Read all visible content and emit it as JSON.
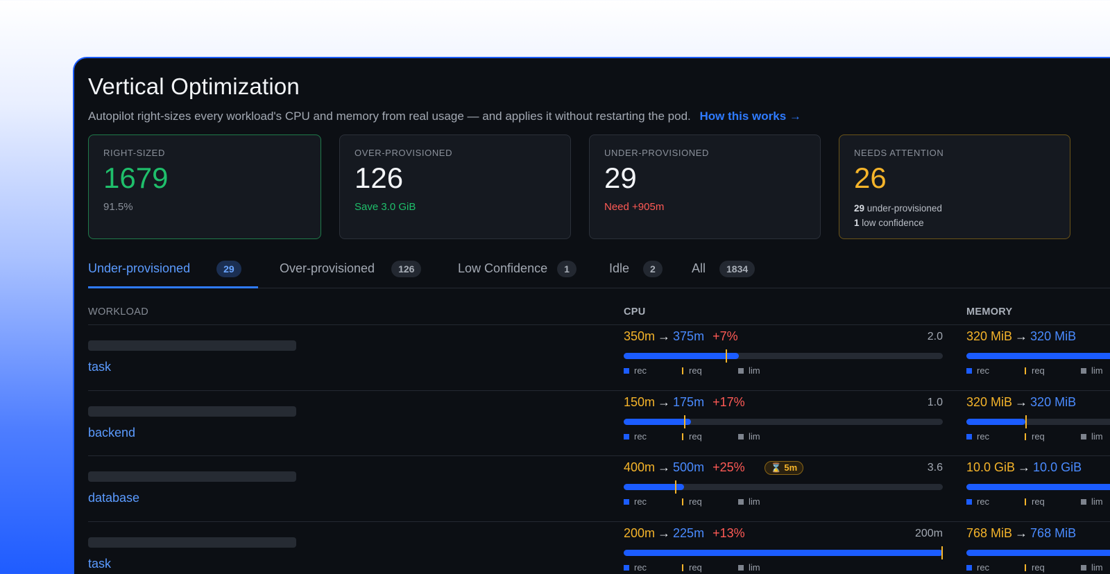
{
  "header": {
    "title": "Vertical Optimization",
    "subtitle": "Autopilot right-sizes every workload's CPU and memory from real usage — and applies it without restarting the pod.",
    "link": "How this works →"
  },
  "cards": {
    "right_sized": {
      "label": "RIGHT-SIZED",
      "value": "1679",
      "sub": "91.5%"
    },
    "over": {
      "label": "OVER-PROVISIONED",
      "value": "126",
      "sub": "Save 3.0 GiB"
    },
    "under": {
      "label": "UNDER-PROVISIONED",
      "value": "29",
      "sub": "Need +905m"
    },
    "attention": {
      "label": "NEEDS ATTENTION",
      "value": "26",
      "line1_num": "29",
      "line1_text": " under-provisioned",
      "line2_num": "1",
      "line2_text": " low confidence"
    }
  },
  "tabs": [
    {
      "label": "Under-provisioned",
      "count": "29"
    },
    {
      "label": "Over-provisioned",
      "count": "126"
    },
    {
      "label": "Low Confidence",
      "count": "1"
    },
    {
      "label": "Idle",
      "count": "2"
    },
    {
      "label": "All",
      "count": "1834"
    }
  ],
  "table": {
    "headers": {
      "workload": "WORKLOAD",
      "cpu": "CPU",
      "memory": "MEMORY"
    },
    "legend": {
      "rec": "rec",
      "req": "req",
      "lim": "lim"
    },
    "rows": [
      {
        "name": "task",
        "cpu": {
          "current": "350m",
          "recommended": "375m",
          "delta": "+7%",
          "max": "2.0",
          "rec_fraction": 0.36,
          "req_fraction": 0.32
        },
        "memory": {
          "current": "320 MiB",
          "recommended": "320 MiB"
        }
      },
      {
        "name": "backend",
        "cpu": {
          "current": "150m",
          "recommended": "175m",
          "delta": "+17%",
          "max": "1.0",
          "rec_fraction": 0.21,
          "req_fraction": 0.19
        },
        "memory": {
          "current": "320 MiB",
          "recommended": "320 MiB"
        }
      },
      {
        "name": "database",
        "cpu": {
          "current": "400m",
          "recommended": "500m",
          "delta": "+25%",
          "max": "3.6",
          "badge": "⌛ 5m",
          "rec_fraction": 0.19,
          "req_fraction": 0.16
        },
        "memory": {
          "current": "10.0 GiB",
          "recommended": "10.0 GiB"
        }
      },
      {
        "name": "task",
        "cpu": {
          "current": "200m",
          "recommended": "225m",
          "delta": "+13%",
          "max": "200m",
          "rec_fraction": 1.0,
          "req_fraction": 1.0
        },
        "memory": {
          "current": "768 MiB",
          "recommended": "768 MiB"
        }
      }
    ]
  },
  "colors": {
    "accent": "#1b5cff",
    "right_sized": "#1fbf6b",
    "attention": "#f5b42a",
    "danger": "#ff5a55"
  }
}
